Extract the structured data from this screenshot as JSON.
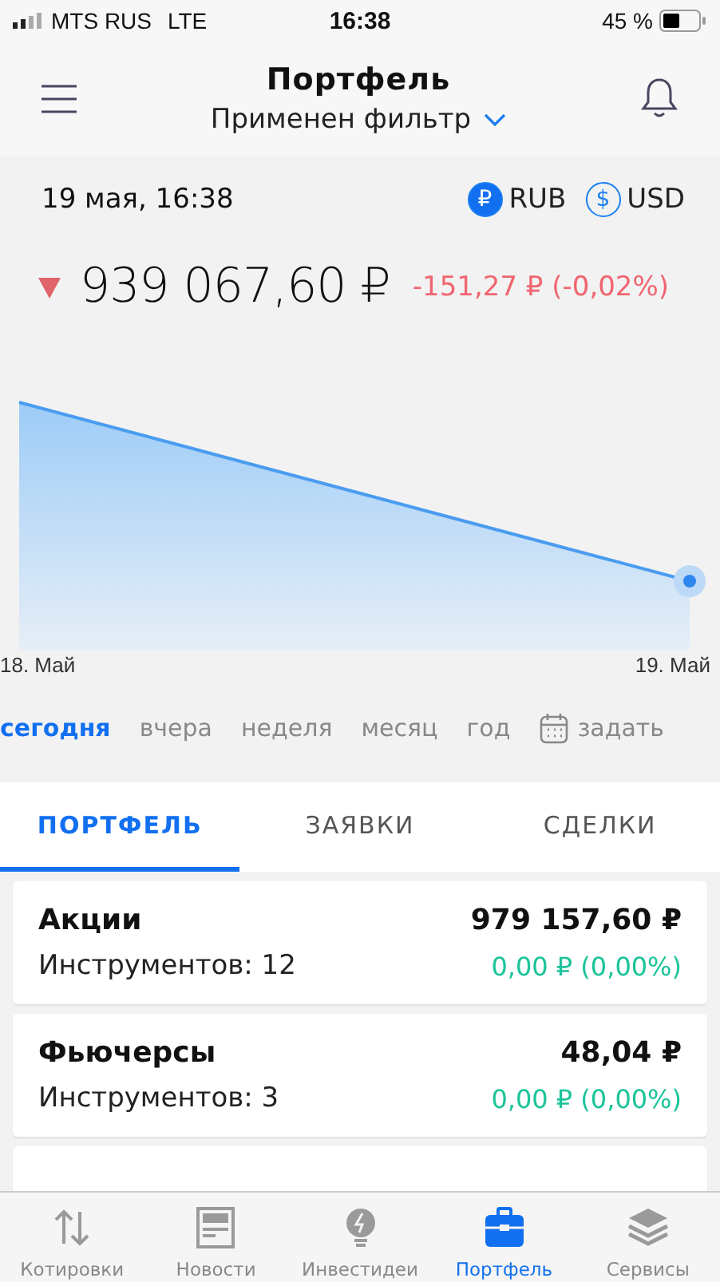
{
  "status_bar": {
    "carrier": "MTS RUS",
    "network": "LTE",
    "time": "16:38",
    "battery": "45 %"
  },
  "header": {
    "title": "Портфель",
    "filter": "Применен фильтр"
  },
  "summary": {
    "date": "19 мая, 16:38",
    "currencies": [
      {
        "symbol": "₽",
        "label": "RUB",
        "selected": true
      },
      {
        "symbol": "$",
        "label": "USD",
        "selected": false
      }
    ],
    "kind": "loss",
    "total": "939 067,60 ₽",
    "change": "-151,27 ₽ (-0,02%)"
  },
  "chart": {
    "x_start": "18. Май",
    "x_end": "19. Май"
  },
  "periods": [
    {
      "label": "сегодня",
      "selected": true
    },
    {
      "label": "вчера",
      "selected": false
    },
    {
      "label": "неделя",
      "selected": false
    },
    {
      "label": "месяц",
      "selected": false
    },
    {
      "label": "год",
      "selected": false
    },
    {
      "label": "задать",
      "selected": false,
      "kind": "custom"
    }
  ],
  "tabs": [
    {
      "label": "ПОРТФЕЛЬ",
      "selected": true
    },
    {
      "label": "ЗАЯВКИ",
      "selected": false
    },
    {
      "label": "СДЕЛКИ",
      "selected": false
    }
  ],
  "positions": [
    {
      "name": "Акции",
      "count": "Инструментов: 12",
      "value": "979 157,60 ₽",
      "change": "0,00 ₽ (0,00%)"
    },
    {
      "name": "Фьючерсы",
      "count": "Инструментов: 3",
      "value": "48,04 ₽",
      "change": "0,00 ₽ (0,00%)"
    }
  ],
  "nav": [
    {
      "kind": "quotes",
      "label": "Котировки",
      "selected": false
    },
    {
      "kind": "news",
      "label": "Новости",
      "selected": false
    },
    {
      "kind": "ideas",
      "label": "Инвестидеи",
      "selected": false
    },
    {
      "kind": "portfolio",
      "label": "Портфель",
      "selected": true
    },
    {
      "kind": "services",
      "label": "Сервисы",
      "selected": false
    }
  ]
}
